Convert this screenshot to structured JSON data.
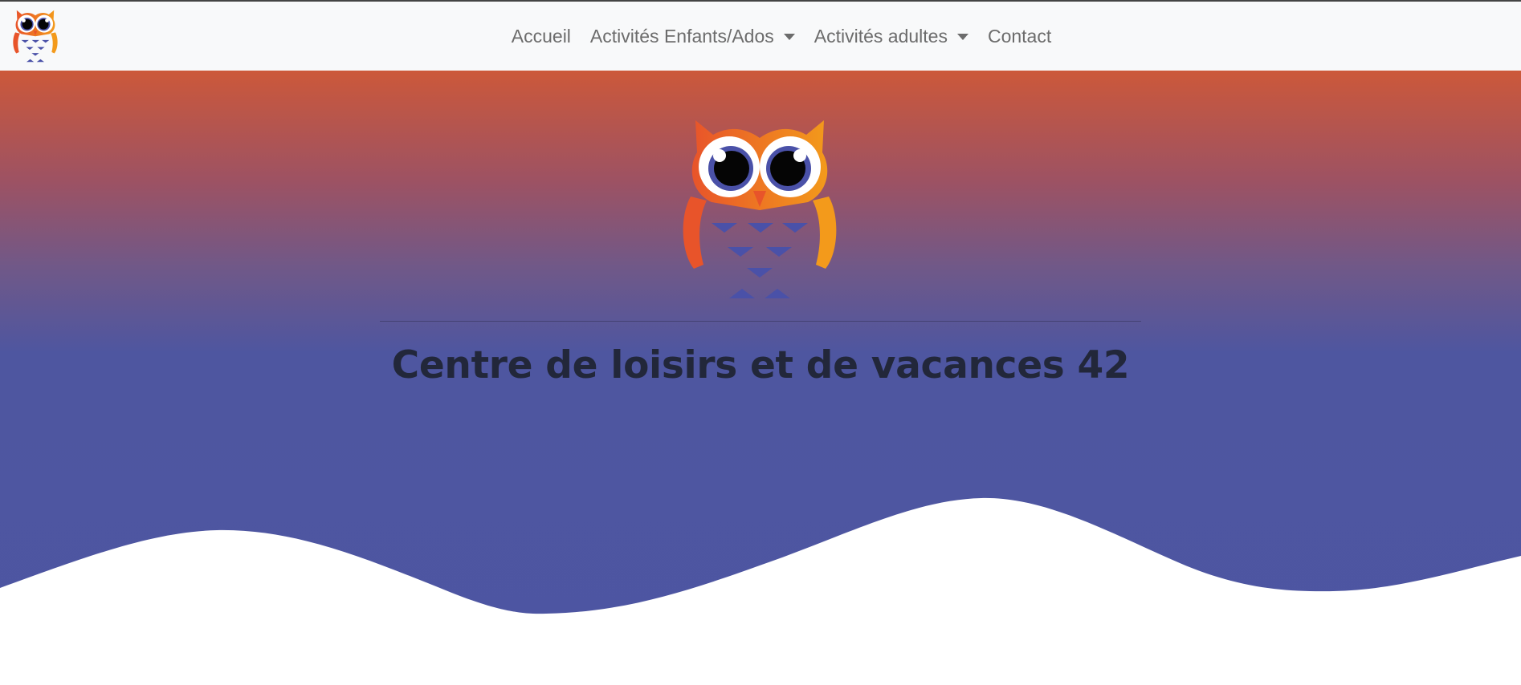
{
  "navbar": {
    "logo_icon": "owl-logo-icon",
    "items": [
      {
        "label": "Accueil",
        "dropdown": false
      },
      {
        "label": "Activités Enfants/Ados",
        "dropdown": true
      },
      {
        "label": "Activités adultes",
        "dropdown": true
      },
      {
        "label": "Contact",
        "dropdown": false
      }
    ]
  },
  "hero": {
    "title": "Centre de loisirs et de vacances 42",
    "illustration_icon": "owl-mascot-icon"
  },
  "colors": {
    "navbar_bg": "#f8f9fa",
    "nav_text": "#6c6c6c",
    "gradient_top": "#cc583a",
    "gradient_bottom": "#4d55a2",
    "owl_orange": "#f07d1e",
    "owl_red": "#e8542a",
    "owl_blue": "#4a51a8",
    "title_text": "#22273a",
    "wave_fill": "#ffffff"
  }
}
